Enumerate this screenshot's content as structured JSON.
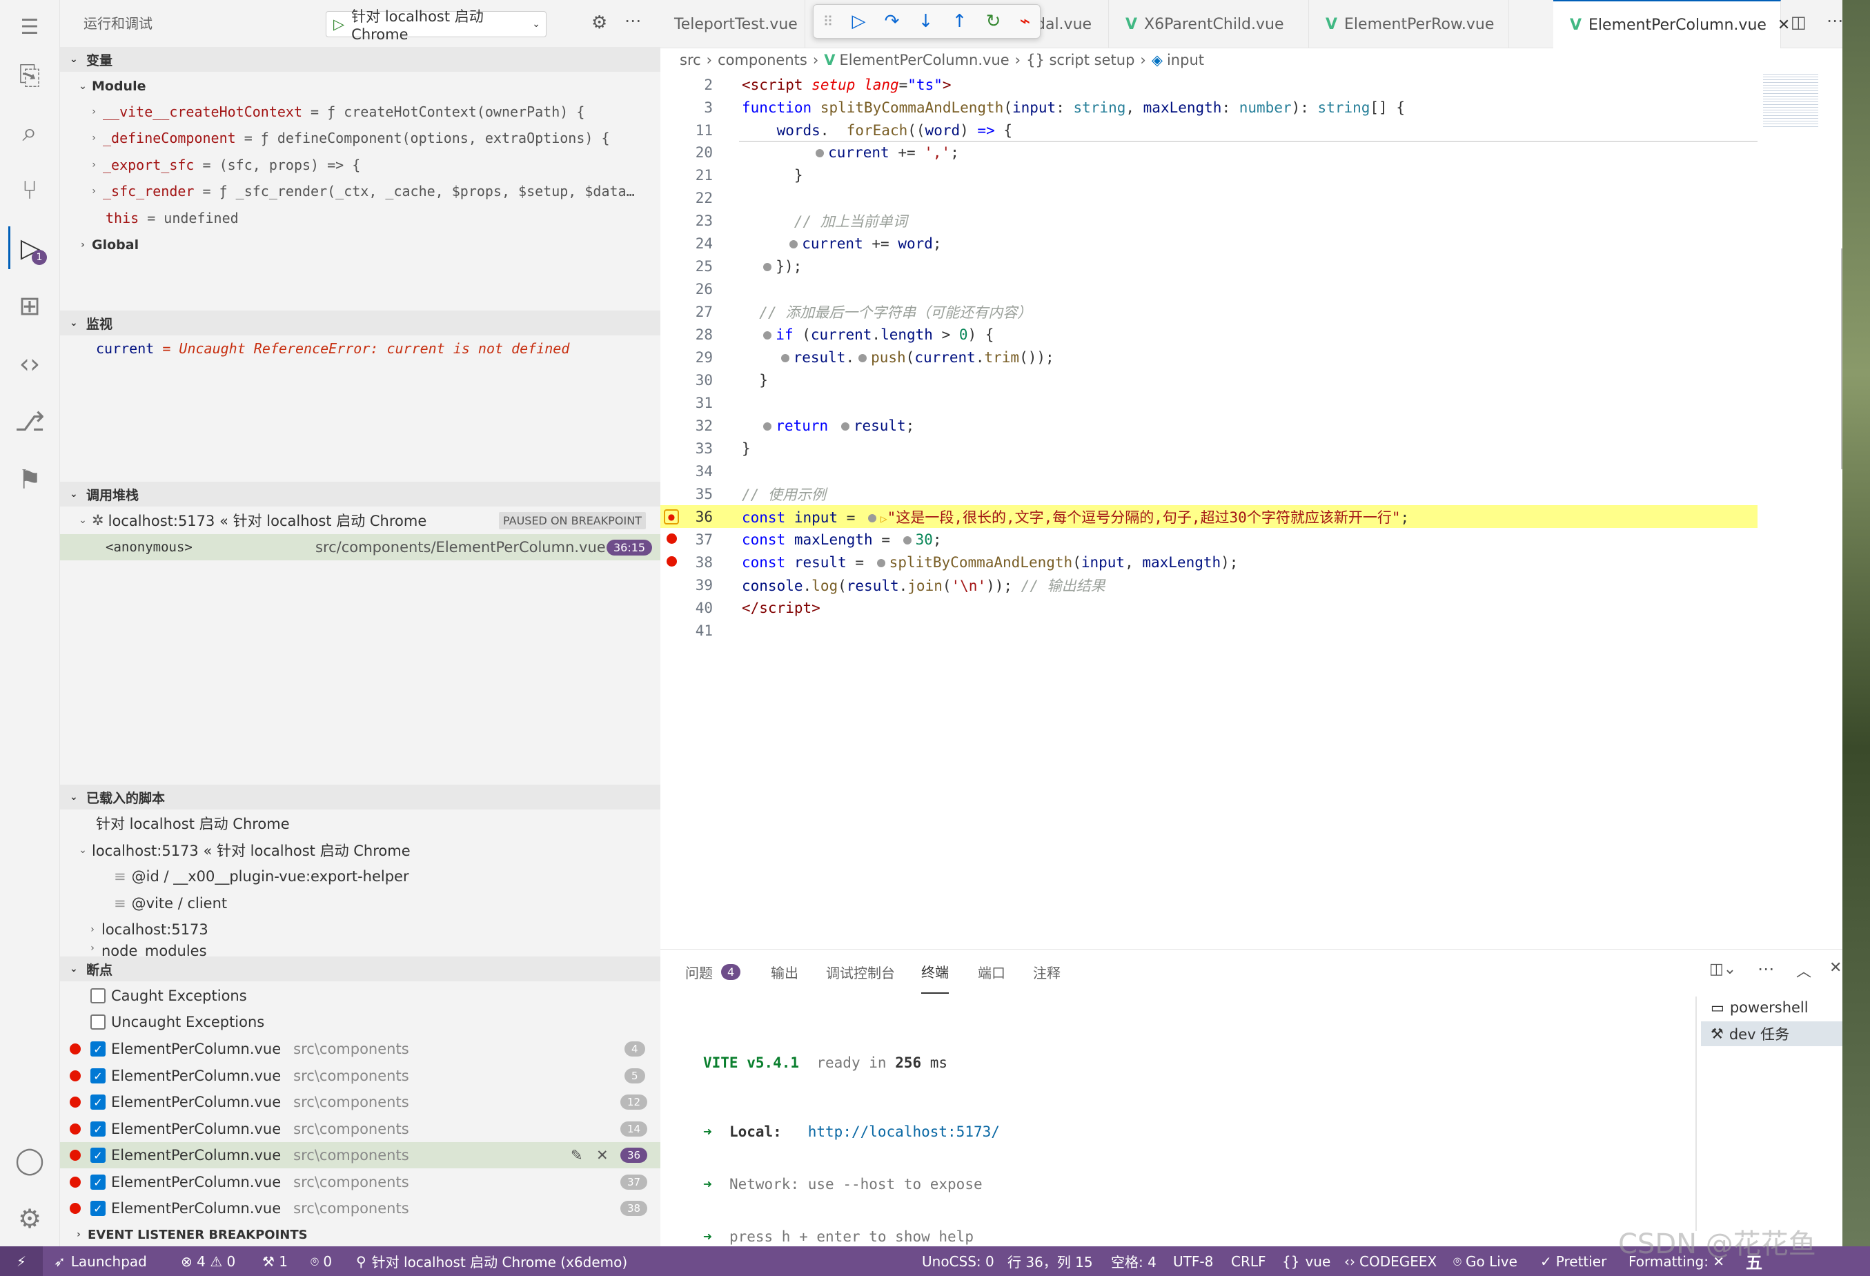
{
  "sidebar": {
    "title": "运行和调试",
    "launch_config": "针对 localhost 启动 Chrome",
    "variables_header": "变量",
    "module_label": "Module",
    "vars": [
      {
        "name": "__vite__createHotContext",
        "value": "= ƒ createHotContext(ownerPath) {"
      },
      {
        "name": "_defineComponent",
        "value": "= ƒ defineComponent(options, extraOptions) {"
      },
      {
        "name": "_export_sfc",
        "value": "= (sfc, props) => {"
      },
      {
        "name": "_sfc_render",
        "value": "= ƒ _sfc_render(_ctx, _cache, $props, $setup, $data…"
      },
      {
        "name": "this",
        "value": "= undefined"
      }
    ],
    "global_label": "Global",
    "watch_header": "监视",
    "watch_name": "current",
    "watch_value": "= Uncaught ReferenceError: current is not defined",
    "callstack_header": "调用堆栈",
    "callstack_session": "localhost:5173 « 针对 localhost 启动 Chrome",
    "callstack_state": "PAUSED ON BREAKPOINT",
    "frame_name": "<anonymous>",
    "frame_file": "src/components/ElementPerColumn.vue",
    "frame_pos": "36:15",
    "scripts_header": "已载入的脚本",
    "scripts": [
      "针对 localhost 启动 Chrome",
      "localhost:5173 « 针对 localhost 启动 Chrome",
      "@id / __x00__plugin-vue:export-helper",
      "@vite / client",
      "localhost:5173",
      "node_modules"
    ],
    "breakpoints_header": "断点",
    "caught": "Caught Exceptions",
    "uncaught": "Uncaught Exceptions",
    "bps": [
      {
        "file": "ElementPerColumn.vue",
        "dir": "src\\components",
        "line": "4"
      },
      {
        "file": "ElementPerColumn.vue",
        "dir": "src\\components",
        "line": "5"
      },
      {
        "file": "ElementPerColumn.vue",
        "dir": "src\\components",
        "line": "12"
      },
      {
        "file": "ElementPerColumn.vue",
        "dir": "src\\components",
        "line": "14"
      },
      {
        "file": "ElementPerColumn.vue",
        "dir": "src\\components",
        "line": "36"
      },
      {
        "file": "ElementPerColumn.vue",
        "dir": "src\\components",
        "line": "37"
      },
      {
        "file": "ElementPerColumn.vue",
        "dir": "src\\components",
        "line": "38"
      }
    ],
    "event_listener": "EVENT LISTENER BREAKPOINTS",
    "debug_badge": "1"
  },
  "tabs": [
    "TeleportTest.vue",
    "dal.vue",
    "X6ParentChild.vue",
    "ElementPerRow.vue",
    "ElementPerColumn.vue"
  ],
  "breadcrumb": [
    "src",
    "components",
    "ElementPerColumn.vue",
    "{} script setup",
    "input"
  ],
  "code": {
    "l2": "2",
    "l3": "3",
    "l11": "11",
    "l20": "20",
    "l21": "21",
    "l22": "22",
    "l23": "23",
    "l24": "24",
    "l25": "25",
    "l26": "26",
    "l27": "27",
    "l28": "28",
    "l29": "29",
    "l30": "30",
    "l31": "31",
    "l32": "32",
    "l33": "33",
    "l34": "34",
    "l35": "35",
    "l36": "36",
    "l37": "37",
    "l38": "38",
    "l39": "39",
    "l40": "40",
    "l41": "41",
    "c23": "// 加上当前单词",
    "c27": "// 添加最后一个字符串（可能还有内容）",
    "c35": "// 使用示例",
    "s36": "\"这是一段,很长的,文字,每个逗号分隔的,句子,超过30个字符就应该新开一行\"",
    "c39": "// 输出结果"
  },
  "panel": {
    "tabs": [
      "问题",
      "输出",
      "调试控制台",
      "终端",
      "端口",
      "注释"
    ],
    "problems_count": "4",
    "terminals": [
      "powershell",
      "dev 任务"
    ],
    "vite": "VITE v5.4.1",
    "ready": "ready in",
    "ms": "256",
    "ms_unit": "ms",
    "local_label": "Local:",
    "local_url": "http://localhost:5173/",
    "network": "Network: use --host to expose",
    "help": "press h + enter to show help"
  },
  "status": {
    "launchpad": "Launchpad",
    "errors": "4",
    "warnings": "0",
    "tools": "1",
    "ports": "0",
    "session": "针对 localhost 启动 Chrome (x6demo)",
    "unocss": "UnoCSS: 0",
    "pos": "行 36，列 15",
    "spaces": "空格: 4",
    "enc": "UTF-8",
    "eol": "CRLF",
    "lang": "vue",
    "codegeex": "CODEGEEX",
    "golive": "Go Live",
    "prettier": "Prettier",
    "formatting": "Formatting: ✕",
    "ime": "五",
    "watermark": "CSDN @花花鱼"
  }
}
